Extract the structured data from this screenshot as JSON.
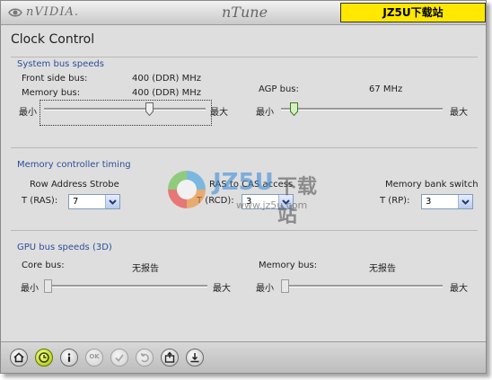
{
  "titlebar": {
    "brand": "nVIDIA.",
    "app_title": "nTune",
    "watermark": "JZ5U下载站(www.jz5u.com)"
  },
  "page": {
    "title": "Clock Control"
  },
  "system_bus": {
    "section_label": "System bus speeds",
    "fsb_label": "Front side bus:",
    "fsb_value": "400 (DDR) MHz",
    "memory_label": "Memory bus:",
    "memory_value": "400 (DDR) MHz",
    "agp_label": "AGP bus:",
    "agp_value": "67 MHz",
    "min_label": "最小",
    "max_label": "最大",
    "fsb_slider_level": 0.66,
    "agp_slider_level": 0.06
  },
  "memory_timing": {
    "section_label": "Memory controller timing",
    "ras_label": "Row Address Strobe",
    "ras_field": "T (RAS):",
    "ras_value": "7",
    "rcd_label": "RAS to CAS access",
    "rcd_field": "T (RCD):",
    "rcd_value": "3",
    "rp_label": "Memory bank switch",
    "rp_field": "T (RP):",
    "rp_value": "3"
  },
  "gpu_bus": {
    "section_label": "GPU bus speeds (3D)",
    "core_label": "Core bus:",
    "core_value": "无报告",
    "memory_label": "Memory bus:",
    "memory_value": "无报告",
    "min_label": "最小",
    "max_label": "最大",
    "core_slider_level": 0.0,
    "memory_slider_level": 0.0
  },
  "watermark_center": {
    "brand": "JZ5U",
    "suffix": "下载站",
    "url": "www.jz5u.com"
  },
  "toolbar": {
    "ok_label": "OK"
  },
  "colors": {
    "section": "#2d4e9a",
    "banner": "#ffe800",
    "active_button": "#a9c000"
  },
  "icons": [
    "nvidia-logo-icon",
    "home-icon",
    "clock-icon",
    "info-icon",
    "ok-icon",
    "check-icon",
    "undo-icon",
    "save-icon",
    "download-icon",
    "chevron-down-icon",
    "slider-thumb-icon"
  ]
}
